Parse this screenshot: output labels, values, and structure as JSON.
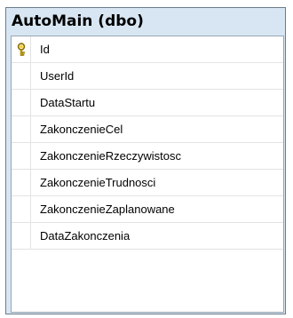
{
  "table": {
    "title": "AutoMain (dbo)",
    "columns": [
      {
        "name": "Id",
        "primary_key": true,
        "icon": "primary-key-icon"
      },
      {
        "name": "UserId",
        "primary_key": false
      },
      {
        "name": "DataStartu",
        "primary_key": false
      },
      {
        "name": "ZakonczenieCel",
        "primary_key": false
      },
      {
        "name": "ZakonczenieRzeczywistosc",
        "primary_key": false
      },
      {
        "name": "ZakonczenieTrudnosci",
        "primary_key": false
      },
      {
        "name": "ZakonczenieZaplanowane",
        "primary_key": false
      },
      {
        "name": "DataZakonczenia",
        "primary_key": false
      }
    ]
  },
  "colors": {
    "title_background": "#d8e6f3",
    "border": "#6b7c8c",
    "key_icon": "#c9a400"
  }
}
